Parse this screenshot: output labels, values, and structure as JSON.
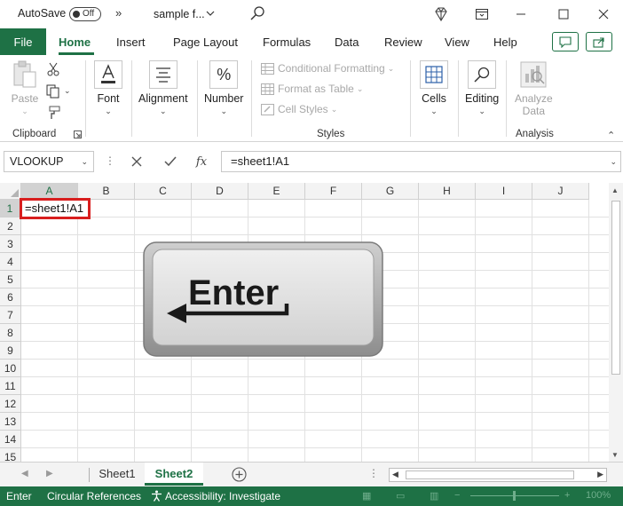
{
  "titlebar": {
    "autosave_label": "AutoSave",
    "autosave_state": "Off",
    "overflow_chevrons": "»",
    "document_name": "sample f..."
  },
  "ribbon_tabs": {
    "file": "File",
    "items": [
      "Home",
      "Insert",
      "Page Layout",
      "Formulas",
      "Data",
      "Review",
      "View",
      "Help"
    ],
    "active": "Home"
  },
  "ribbon": {
    "clipboard": {
      "paste_label": "Paste",
      "group_label": "Clipboard"
    },
    "font": {
      "label": "Font",
      "caret": "⌄"
    },
    "alignment": {
      "label": "Alignment",
      "caret": "⌄"
    },
    "number": {
      "label": "Number",
      "caret": "⌄"
    },
    "styles": {
      "conditional_formatting": "Conditional Formatting",
      "format_as_table": "Format as Table",
      "cell_styles": "Cell Styles",
      "group_label": "Styles"
    },
    "cells": {
      "label": "Cells",
      "caret": "⌄"
    },
    "editing": {
      "label": "Editing",
      "caret": "⌄"
    },
    "analysis": {
      "analyze_label_1": "Analyze",
      "analyze_label_2": "Data",
      "group_label": "Analysis"
    },
    "collapse_caret": "⌃"
  },
  "formula_bar": {
    "name_box": "VLOOKUP",
    "fx_label": "fx",
    "formula": "=sheet1!A1"
  },
  "grid": {
    "columns": [
      "A",
      "B",
      "C",
      "D",
      "E",
      "F",
      "G",
      "H",
      "I",
      "J"
    ],
    "selected_column": "A",
    "rows": [
      "1",
      "2",
      "3",
      "4",
      "5",
      "6",
      "7",
      "8",
      "9",
      "10",
      "11",
      "12",
      "13",
      "14",
      "15"
    ],
    "selected_row": "1",
    "active_cell_content": "=sheet1!A1"
  },
  "overlay": {
    "key_label": "Enter"
  },
  "sheets": {
    "tabs": [
      "Sheet1",
      "Sheet2"
    ],
    "active": "Sheet2"
  },
  "statusbar": {
    "mode": "Enter",
    "circular": "Circular References",
    "accessibility": "Accessibility: Investigate",
    "zoom": "100%"
  },
  "colors": {
    "excel_green": "#1e7145",
    "highlight_red": "#d81e1e"
  }
}
